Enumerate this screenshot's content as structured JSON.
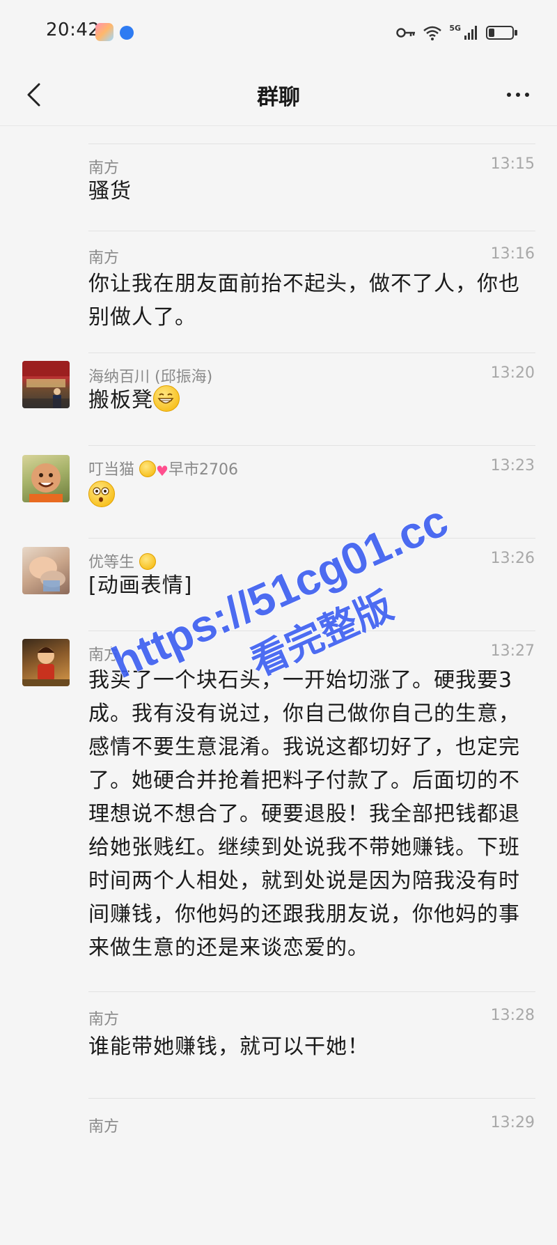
{
  "status_bar": {
    "time": "20:42",
    "network": "5G",
    "battery_level": 0.25
  },
  "nav": {
    "title": "群聊"
  },
  "messages": [
    {
      "sender": "南方",
      "time": "13:15",
      "text": "骚货"
    },
    {
      "sender": "南方",
      "time": "13:16",
      "text": "你让我在朋友面前抬不起头，做不了人，你也别做人了。"
    },
    {
      "sender": "海纳百川 (邱振海)",
      "time": "13:20",
      "text": "搬板凳"
    },
    {
      "sender_prefix": "叮当猫",
      "sender_suffix": "早市2706",
      "time": "13:23",
      "text": ""
    },
    {
      "sender": "优等生",
      "time": "13:26",
      "text": "[动画表情]"
    },
    {
      "sender": "南方",
      "time": "13:27",
      "text": "我买了一个块石头，一开始切涨了。硬我要3成。我有没有说过，你自己做你自己的生意，感情不要生意混淆。我说这都切好了，也定完了。她硬合并抢着把料子付款了。后面切的不理想说不想合了。硬要退股！我全部把钱都退给她张贱红。继续到处说我不带她赚钱。下班时间两个人相处，就到处说是因为陪我没有时间赚钱，你他妈的还跟我朋友说，你他妈的事来做生意的还是来谈恋爱的。"
    },
    {
      "sender": "南方",
      "time": "13:28",
      "text": "谁能带她赚钱，就可以干她！"
    },
    {
      "sender": "南方",
      "time": "13:29"
    }
  ],
  "watermark": {
    "line1": "https://51cg01.cc",
    "line2": "看完整版"
  },
  "colors": {
    "background": "#f5f5f5",
    "text_primary": "#1a1a1a",
    "text_secondary": "#8a8a8a",
    "watermark": "#3a5cf0"
  },
  "icons": [
    "back-arrow-icon",
    "more-dots-icon",
    "key-icon",
    "wifi-icon",
    "signal-icon",
    "battery-icon"
  ]
}
